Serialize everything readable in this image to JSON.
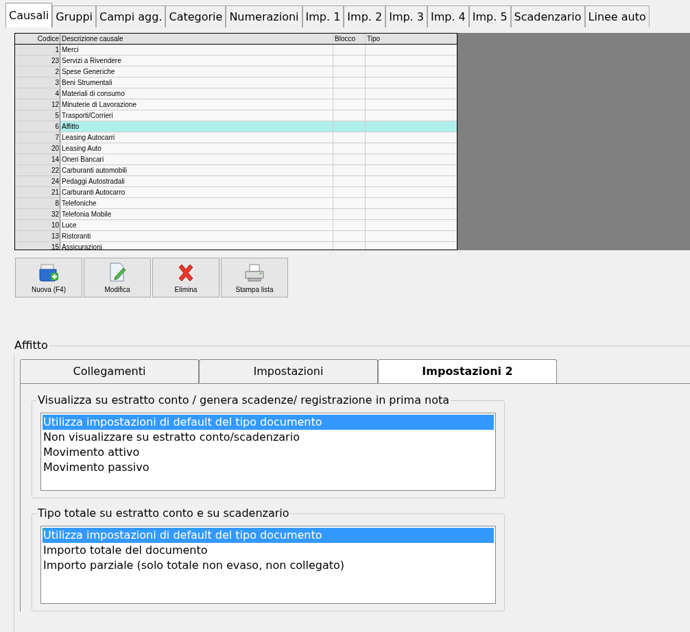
{
  "top_tabs": [
    {
      "label": "Causali",
      "selected": true
    },
    {
      "label": "Gruppi",
      "selected": false
    },
    {
      "label": "Campi agg.",
      "selected": false
    },
    {
      "label": "Categorie",
      "selected": false
    },
    {
      "label": "Numerazioni",
      "selected": false
    },
    {
      "label": "Imp. 1",
      "selected": false
    },
    {
      "label": "Imp. 2",
      "selected": false
    },
    {
      "label": "Imp. 3",
      "selected": false
    },
    {
      "label": "Imp. 4",
      "selected": false
    },
    {
      "label": "Imp. 5",
      "selected": false
    },
    {
      "label": "Scadenzario",
      "selected": false
    },
    {
      "label": "Linee auto",
      "selected": false
    }
  ],
  "table": {
    "columns": [
      "Codice",
      "Descrizione causale",
      "Blocco",
      "Tipo"
    ],
    "rows": [
      {
        "code": "1",
        "description": "Merci",
        "selected": false
      },
      {
        "code": "23",
        "description": "Servizi a Rivendere",
        "selected": false
      },
      {
        "code": "2",
        "description": "Spese Generiche",
        "selected": false
      },
      {
        "code": "3",
        "description": "Beni Strumentali",
        "selected": false
      },
      {
        "code": "4",
        "description": "Materiali di consumo",
        "selected": false
      },
      {
        "code": "12",
        "description": "Minuterie di Lavorazione",
        "selected": false
      },
      {
        "code": "5",
        "description": "Trasporti/Corrieri",
        "selected": false
      },
      {
        "code": "6",
        "description": "Affitto",
        "selected": true
      },
      {
        "code": "7",
        "description": "Leasing Autocarri",
        "selected": false
      },
      {
        "code": "20",
        "description": "Leasing Auto",
        "selected": false
      },
      {
        "code": "14",
        "description": "Oneri Bancari",
        "selected": false
      },
      {
        "code": "22",
        "description": "Carburanti automobili",
        "selected": false
      },
      {
        "code": "24",
        "description": "Pedaggi Autostradali",
        "selected": false
      },
      {
        "code": "21",
        "description": "Carburanti Autocarro",
        "selected": false
      },
      {
        "code": "8",
        "description": "Telefoniche",
        "selected": false
      },
      {
        "code": "32",
        "description": "Telefonia Mobile",
        "selected": false
      },
      {
        "code": "10",
        "description": "Luce",
        "selected": false
      },
      {
        "code": "13",
        "description": "Ristoranti",
        "selected": false
      },
      {
        "code": "15",
        "description": "Assicurazioni",
        "selected": false
      }
    ]
  },
  "toolbar": [
    {
      "kind": "new",
      "label": "Nuova (F4)"
    },
    {
      "kind": "edit",
      "label": "Modifica"
    },
    {
      "kind": "delete",
      "label": "Elimina"
    },
    {
      "kind": "print",
      "label": "Stampa lista"
    }
  ],
  "detail": {
    "title": "Affitto",
    "tabs": [
      {
        "label": "Collegamenti",
        "selected": false
      },
      {
        "label": "Impostazioni",
        "selected": false
      },
      {
        "label": "Impostazioni 2",
        "selected": true
      }
    ],
    "groups": [
      {
        "title": "Visualizza su estratto conto / genera scadenze/ registrazione  in prima nota",
        "options": [
          {
            "label": "Utilizza impostazioni di default del tipo documento",
            "selected": true
          },
          {
            "label": "Non visualizzare su estratto conto/scadenzario",
            "selected": false
          },
          {
            "label": "Movimento attivo",
            "selected": false
          },
          {
            "label": "Movimento passivo",
            "selected": false
          }
        ]
      },
      {
        "title": "Tipo totale su estratto conto e su scadenzario",
        "options": [
          {
            "label": "Utilizza impostazioni di default del tipo documento",
            "selected": true
          },
          {
            "label": "Importo totale del documento",
            "selected": false
          },
          {
            "label": "Importo parziale (solo totale non evaso, non collegato)",
            "selected": false
          }
        ]
      }
    ]
  }
}
